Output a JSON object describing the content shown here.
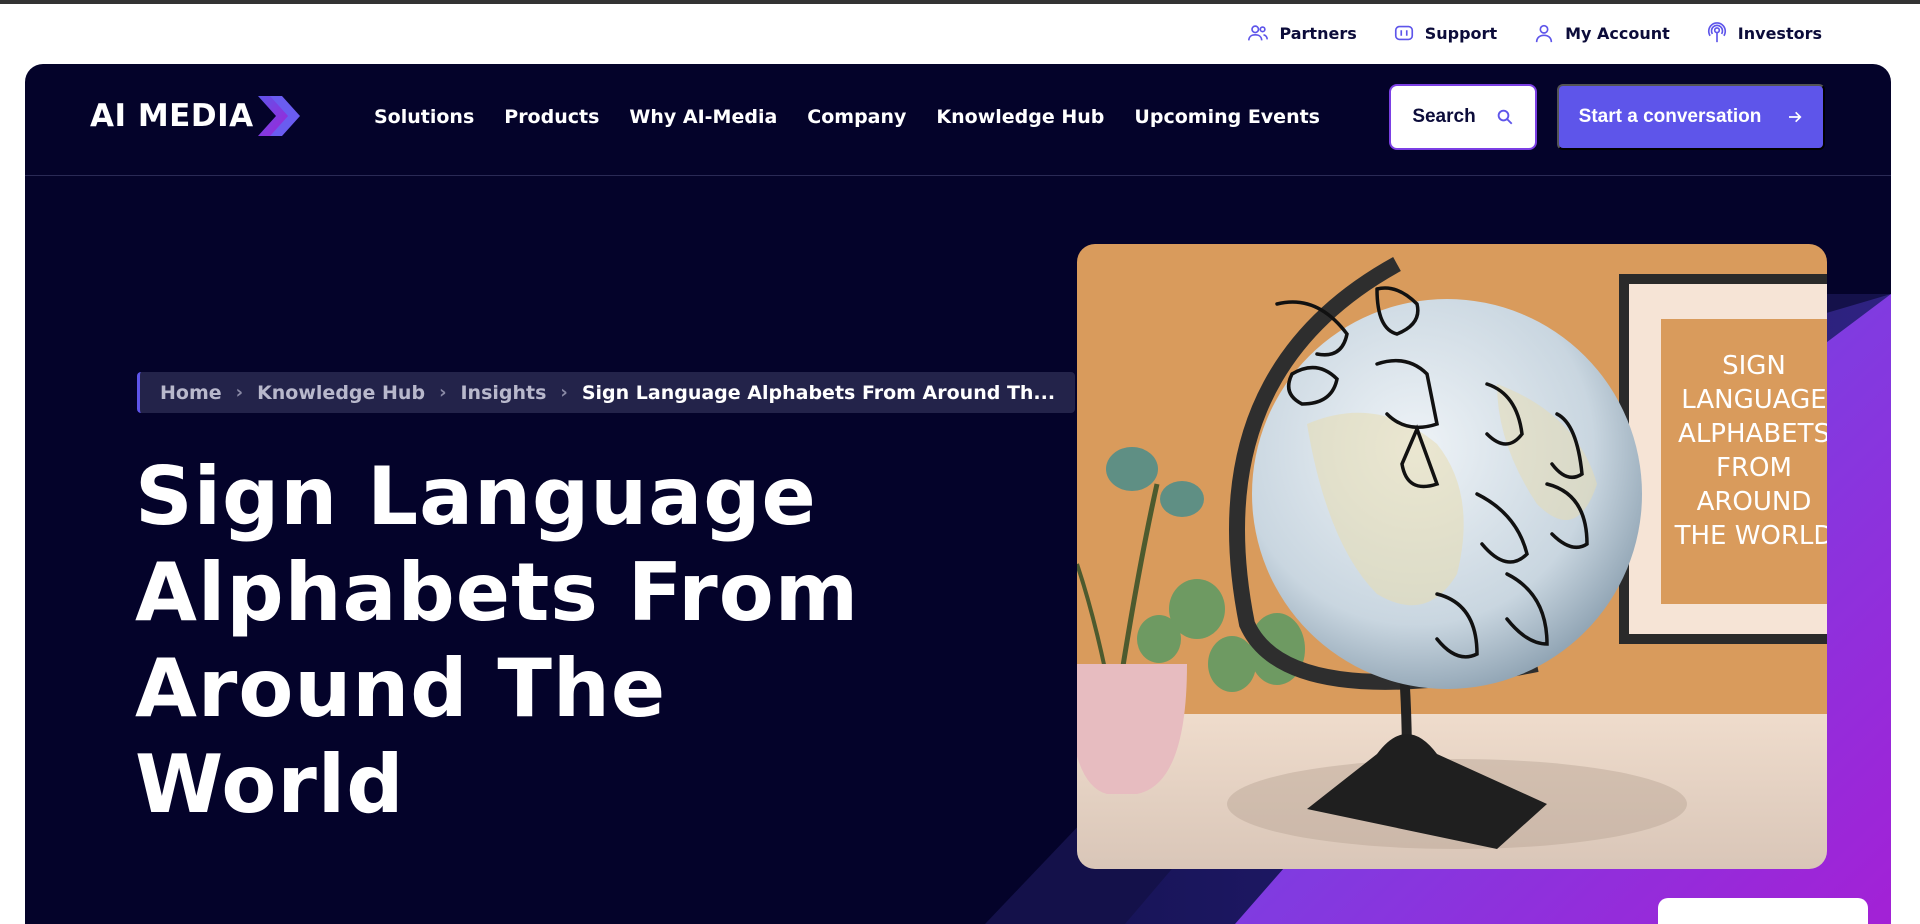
{
  "utility_nav": [
    {
      "label": "Partners",
      "icon": "partners-icon"
    },
    {
      "label": "Support",
      "icon": "support-icon"
    },
    {
      "label": "My Account",
      "icon": "account-icon"
    },
    {
      "label": "Investors",
      "icon": "investors-icon"
    }
  ],
  "logo": {
    "text": "AI MEDIA",
    "icon": "chevron-arrow-icon"
  },
  "main_nav": [
    "Solutions",
    "Products",
    "Why AI-Media",
    "Company",
    "Knowledge Hub",
    "Upcoming Events"
  ],
  "search": {
    "label": "Search",
    "icon": "search-icon"
  },
  "cta": {
    "label": "Start a conversation",
    "icon": "arrow-right-icon"
  },
  "breadcrumb": {
    "items": [
      "Home",
      "Knowledge Hub",
      "Insights"
    ],
    "current": "Sign Language Alphabets From Around Th..."
  },
  "page": {
    "title_lines": [
      "Sign Language",
      "Alphabets From",
      "Around The World"
    ]
  },
  "hero_image": {
    "poster_lines": [
      "SIGN",
      "LANGUAGE",
      "ALPHABETS",
      "FROM",
      "AROUND",
      "THE WORLD"
    ]
  },
  "colors": {
    "hero_bg": "#04032a",
    "accent": "#5e55ea",
    "gradient_end": "#9b2ad9",
    "image_wall": "#d99b5c"
  }
}
